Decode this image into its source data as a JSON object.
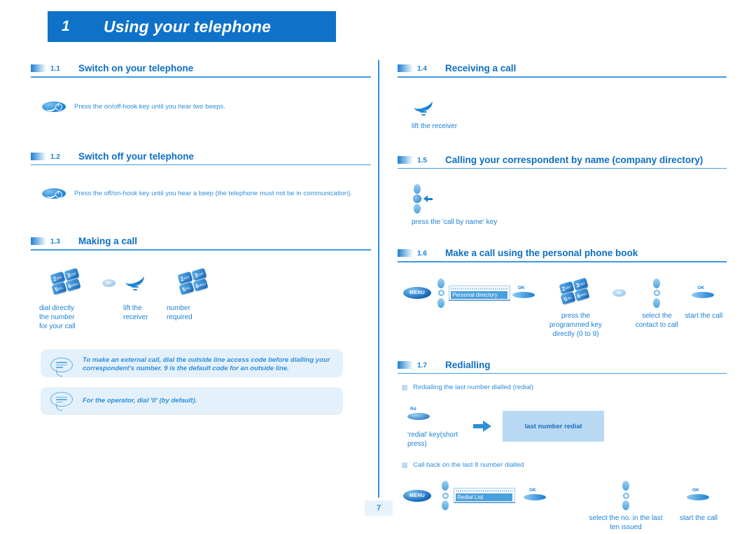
{
  "chapter": {
    "number": "1",
    "title": "Using your telephone"
  },
  "page_number": "7",
  "sections": {
    "s11": {
      "num": "1.1",
      "title": "Switch on your telephone",
      "instruction": "Press the on/off-hook key until you hear two beeps.",
      "icon": "hook-key-icon"
    },
    "s12": {
      "num": "1.2",
      "title": "Switch off your telephone",
      "instruction": "Press the off/on-hook key until you hear a beep (the telephone must not be in communication).",
      "icon": "hook-key-icon"
    },
    "s13": {
      "num": "1.3",
      "title": "Making a call",
      "steps": [
        {
          "icon": "keypad-icon",
          "caption": "dial directly\nthe number\nfor your call"
        },
        {
          "icon": "or-badge",
          "caption": ""
        },
        {
          "icon": "lift-receiver-icon",
          "caption": "lift the\nreceiver"
        },
        {
          "icon": "keypad-icon",
          "caption": "number\nrequired"
        }
      ],
      "notes": [
        "To make an external call, dial the outside line access code before dialling your correspondent's number. 9 is the default code for an outside line.",
        "For the operator, dial '0' (by default)."
      ]
    },
    "s14": {
      "num": "1.4",
      "title": "Receiving a call",
      "caption": "lift the receiver",
      "icon": "lift-receiver-icon"
    },
    "s15": {
      "num": "1.5",
      "title": "Calling your correspondent by name (company directory)",
      "caption": "press the 'call by name' key",
      "icon": "navigator-key-icon"
    },
    "s16": {
      "num": "1.6",
      "title": "Make a call using the personal phone book",
      "lcd_text": "Personal directory",
      "menu_label": "MENU",
      "ok_label": "OK",
      "or_label": "or",
      "captions": {
        "programmed_key": "press the\nprogrammed key\ndirectly (0 to 9)",
        "select_contact": "select the\ncontact to call",
        "start_call": "start the call"
      }
    },
    "s17": {
      "num": "1.7",
      "title": "Redialling",
      "bullet1": "Redialling the last number dialled (redial)",
      "redial_key_label": "Rd",
      "redial_caption": "'redial' key(short\npress)",
      "panel_text": "last number redial",
      "bullet2": "Call back on the last 8 number dialled",
      "menu_label": "MENU",
      "lcd_text": "Redial List",
      "ok_label": "OK",
      "captions": {
        "select_number": "select the no. in the last\nten issued",
        "start_call": "start the call"
      }
    }
  },
  "keypad_digits": [
    {
      "digit": "2",
      "letters": "ABC"
    },
    {
      "digit": "3",
      "letters": "DEF"
    },
    {
      "digit": "5",
      "letters": "JKL"
    },
    {
      "digit": "6",
      "letters": "MNO"
    }
  ],
  "colors": {
    "brand_blue": "#0f72c8",
    "text_blue": "#1a7fd4",
    "light_blue": "#2f8fd8",
    "note_bg": "#e4f1fb",
    "panel_bg": "#b9d9f2",
    "lcd_highlight": "#4a9fdd"
  }
}
